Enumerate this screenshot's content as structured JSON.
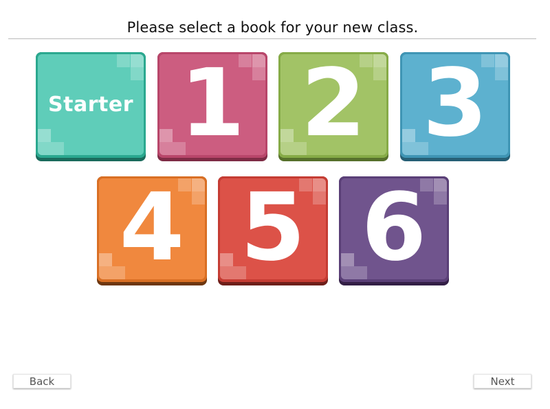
{
  "header": {
    "title": "Please select a book for your new class."
  },
  "books": [
    {
      "label": "Starter",
      "color": "#5fcdb9",
      "edge": "#2aa88f",
      "shadow": "#1a6b5c"
    },
    {
      "label": "1",
      "color": "#cc5d80",
      "edge": "#b8466a",
      "shadow": "#7e2b45"
    },
    {
      "label": "2",
      "color": "#a2c366",
      "edge": "#86ab47",
      "shadow": "#56702b"
    },
    {
      "label": "3",
      "color": "#5db1cf",
      "edge": "#3f95b4",
      "shadow": "#265f75"
    },
    {
      "label": "4",
      "color": "#f0883e",
      "edge": "#d96f24",
      "shadow": "#6e3710"
    },
    {
      "label": "5",
      "color": "#dc5248",
      "edge": "#c53c33",
      "shadow": "#6e1f1a"
    },
    {
      "label": "6",
      "color": "#70548d",
      "edge": "#5a3f77",
      "shadow": "#331f46"
    }
  ],
  "footer": {
    "back_label": "Back",
    "next_label": "Next"
  }
}
